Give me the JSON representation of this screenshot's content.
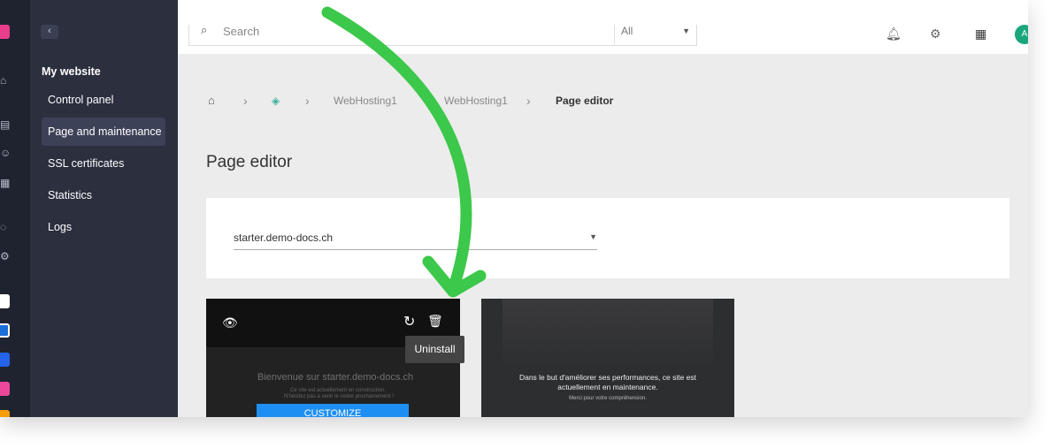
{
  "nav": {
    "back_icon": "‹",
    "heading": "My website",
    "items": [
      {
        "label": "Control panel"
      },
      {
        "label": "Page and maintenance"
      },
      {
        "label": "SSL certificates"
      },
      {
        "label": "Statistics"
      },
      {
        "label": "Logs"
      }
    ]
  },
  "topbar": {
    "search_placeholder": "Search",
    "search_scope": "All",
    "avatar_initial": "A"
  },
  "breadcrumb": {
    "items": [
      "WebHosting1",
      "WebHosting1",
      "Page editor"
    ]
  },
  "page": {
    "title": "Page editor"
  },
  "domain_select": {
    "value": "starter.demo-docs.ch"
  },
  "card1": {
    "welcome": "Bienvenue sur starter.demo-docs.ch",
    "line1": "Ce site est actuellement en construction.",
    "line2": "N'hésitez pas à venir le visiter prochainement !",
    "customize": "CUSTOMIZE",
    "tooltip": "Uninstall"
  },
  "card2": {
    "message": "Dans le but d'améliorer ses performances, ce site est actuellement en maintenance.",
    "thanks": "Merci pour votre compréhension."
  },
  "colors": {
    "sidebar": "#2b2f3e",
    "rail": "#1f2330",
    "accent_green": "#3cc84a",
    "customize_blue": "#1e8ff2"
  }
}
